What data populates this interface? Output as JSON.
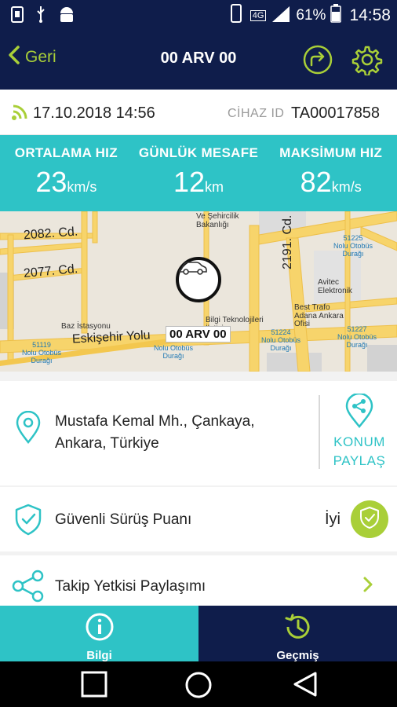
{
  "status_bar": {
    "network": "4G",
    "battery": "61%",
    "time": "14:58"
  },
  "header": {
    "back_label": "Geri",
    "title": "00 ARV 00"
  },
  "info": {
    "datetime": "17.10.2018 14:56",
    "device_label": "CİHAZ ID",
    "device_id": "TA00017858"
  },
  "stats": [
    {
      "label": "ORTALAMA HIZ",
      "value": "23",
      "unit": "km/s"
    },
    {
      "label": "GÜNLÜK MESAFE",
      "value": "12",
      "unit": "km"
    },
    {
      "label": "MAKSİMUM HIZ",
      "value": "82",
      "unit": "km/s"
    }
  ],
  "map": {
    "roads": [
      "2082. Cd.",
      "2077. Cd.",
      "Eskişehir Yolu",
      "2191. Cd."
    ],
    "poi": {
      "bakanlik": "Ve Şehircilik\nBakanlığı",
      "stop1": "51225\nNolu Otobüs\nDurağı",
      "baz": "Baz İstasyonu",
      "bilgi": "Bilgi Teknolojileri\nİletişim\nMüd.",
      "avitec": "Avitec\nElektronik",
      "best": "Best Trafo\nAdana Ankara\nOfisi",
      "stop2": "51224\nNolu Otobüs\nDurağı",
      "stop3": "51227\nNolu Otobüs\nDurağı",
      "stop4": "51119\nNolu Otobüs\nDurağı",
      "stop5": "Nolu Otobüs\nDurağı"
    },
    "plate": "00 ARV 00"
  },
  "address": {
    "line1": "Mustafa Kemal Mh., Çankaya,",
    "line2": "Ankara, Türkiye",
    "share_line1": "KONUM",
    "share_line2": "PAYLAŞ"
  },
  "drive": {
    "label": "Güvenli Sürüş Puanı",
    "score": "İyi"
  },
  "tracking": {
    "label": "Takip Yetkisi Paylaşımı"
  },
  "tabs": [
    {
      "label": "Bilgi"
    },
    {
      "label": "Geçmiş"
    }
  ],
  "colors": {
    "navy": "#0f1d4b",
    "teal": "#2ec3c6",
    "lime": "#a9cf38"
  }
}
